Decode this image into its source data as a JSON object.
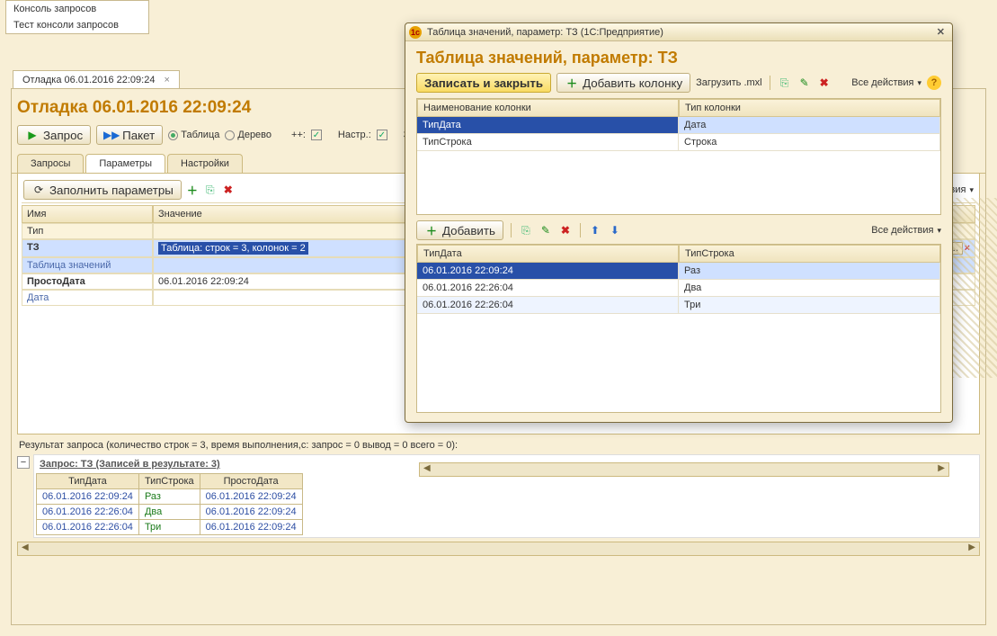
{
  "menu": {
    "items": [
      "Консоль запросов",
      "Тест консоли запросов"
    ]
  },
  "main_tab": {
    "label": "Отладка 06.01.2016 22:09:24"
  },
  "doc_title": "Отладка 06.01.2016 22:09:24",
  "toolbar": {
    "query_btn": "Запрос",
    "packet_btn": "Пакет",
    "view_table": "Таблица",
    "view_tree": "Дерево",
    "plusplus": "++:",
    "nastr_label": "Настр.:",
    "za_label": "За"
  },
  "tabs": {
    "queries": "Запросы",
    "params": "Параметры",
    "settings": "Настройки"
  },
  "params_panel": {
    "fill_btn": "Заполнить параметры",
    "all_actions": "Все действия",
    "col_name": "Имя",
    "col_value": "Значение",
    "type_label": "Тип",
    "rows": [
      {
        "name": "ТЗ",
        "type": "Таблица значений",
        "value": "Таблица: строк = 3, колонок = 2"
      },
      {
        "name": "ПростоДата",
        "type": "Дата",
        "value": "06.01.2016 22:09:24"
      }
    ]
  },
  "result_bar": "Результат запроса (количество строк = 3, время выполнения,с: запрос = 0  вывод = 0  всего = 0):",
  "result": {
    "title": "Запрос: ТЗ (Записей в результате: 3)",
    "columns": [
      "ТипДата",
      "ТипСтрока",
      "ПростоДата"
    ],
    "rows": [
      [
        "06.01.2016 22:09:24",
        "Раз",
        "06.01.2016 22:09:24"
      ],
      [
        "06.01.2016 22:26:04",
        "Два",
        "06.01.2016 22:09:24"
      ],
      [
        "06.01.2016 22:26:04",
        "Три",
        "06.01.2016 22:09:24"
      ]
    ]
  },
  "modal": {
    "window_title": "Таблица значений, параметр: ТЗ  (1С:Предприятие)",
    "title": "Таблица значений, параметр: ТЗ",
    "write_close": "Записать и закрыть",
    "add_column": "Добавить колонку",
    "load_mxl": "Загрузить .mxl",
    "all_actions": "Все действия",
    "cols_grid": {
      "h1": "Наименование колонки",
      "h2": "Тип колонки",
      "rows": [
        {
          "name": "ТипДата",
          "type": "Дата"
        },
        {
          "name": "ТипСтрока",
          "type": "Строка"
        }
      ]
    },
    "add_btn": "Добавить",
    "data_grid": {
      "h1": "ТипДата",
      "h2": "ТипСтрока",
      "rows": [
        {
          "c1": "06.01.2016 22:09:24",
          "c2": "Раз"
        },
        {
          "c1": "06.01.2016 22:26:04",
          "c2": "Два"
        },
        {
          "c1": "06.01.2016 22:26:04",
          "c2": "Три"
        }
      ]
    }
  }
}
